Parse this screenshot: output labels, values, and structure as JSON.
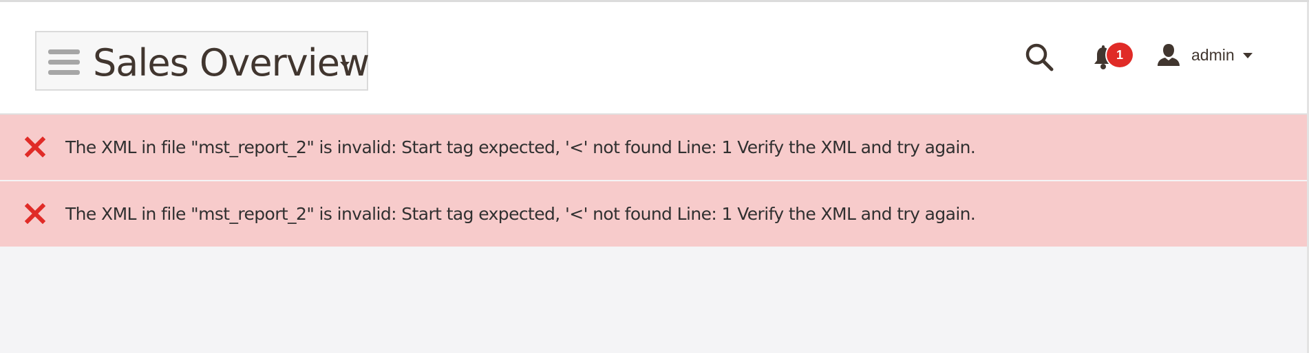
{
  "header": {
    "title": "Sales Overview",
    "menu_icon": "hamburger-icon",
    "search_icon": "search-icon",
    "notifications": {
      "icon": "bell-icon",
      "count": "1",
      "badge_color": "#e02b27"
    },
    "user": {
      "icon": "user-icon",
      "name": "admin"
    }
  },
  "messages": [
    {
      "type": "error",
      "icon": "error-x-icon",
      "text": "The XML in file \"mst_report_2\" is invalid: Start tag expected, '<' not found Line: 1 Verify the XML and try again."
    },
    {
      "type": "error",
      "icon": "error-x-icon",
      "text": "The XML in file \"mst_report_2\" is invalid: Start tag expected, '<' not found Line: 1 Verify the XML and try again."
    }
  ],
  "colors": {
    "error_background": "#f7cbcb",
    "error_icon": "#e02b27",
    "text": "#303030",
    "header_background": "#ffffff",
    "page_background": "#f4f4f6"
  }
}
